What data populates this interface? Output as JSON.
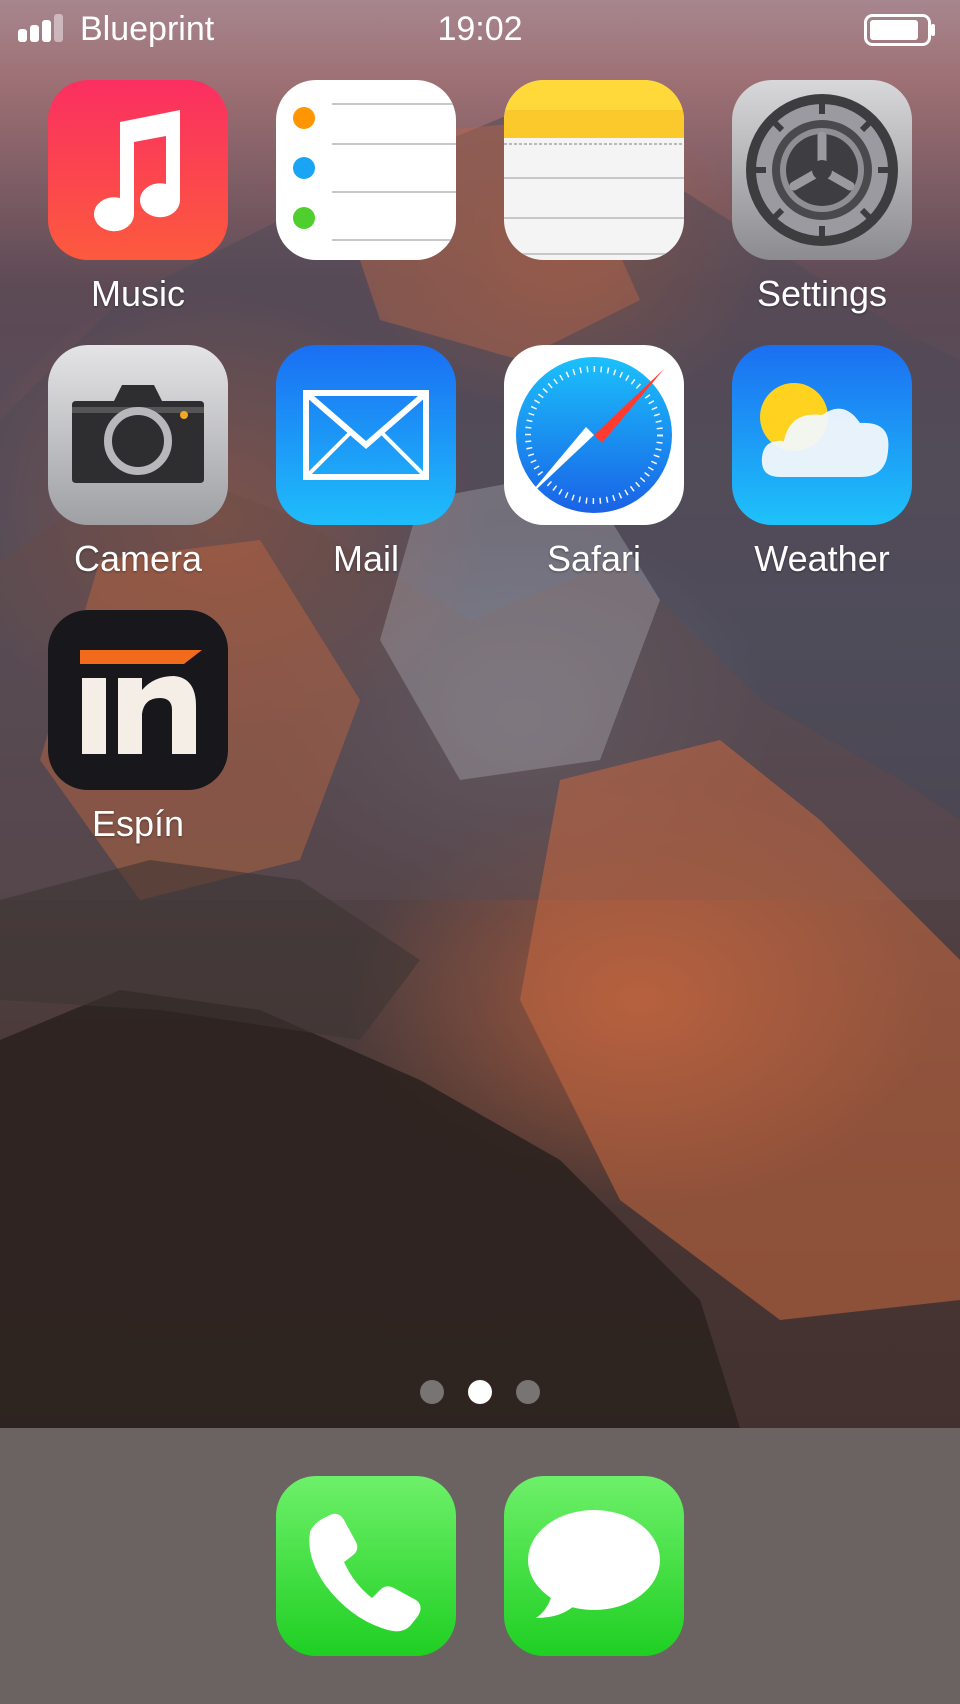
{
  "status_bar": {
    "carrier": "Blueprint",
    "time": "19:02",
    "signal_bars": 4
  },
  "apps": [
    {
      "label": "Music",
      "icon": "music-note-icon"
    },
    {
      "label": "",
      "icon": "reminders-list-icon"
    },
    {
      "label": "",
      "icon": "notes-pad-icon"
    },
    {
      "label": "Settings",
      "icon": "gear-icon"
    },
    {
      "label": "Camera",
      "icon": "camera-icon"
    },
    {
      "label": "Mail",
      "icon": "envelope-icon"
    },
    {
      "label": "Safari",
      "icon": "compass-icon"
    },
    {
      "label": "Weather",
      "icon": "sun-cloud-icon"
    },
    {
      "label": "Espín",
      "icon": "in-logo-icon"
    }
  ],
  "page_indicator": {
    "pages": 3,
    "current": 2
  },
  "dock": [
    {
      "label": "",
      "icon": "phone-icon"
    },
    {
      "label": "",
      "icon": "speech-bubble-icon"
    }
  ],
  "colors": {
    "music": "#fb3c5f",
    "mail": "#1b8cf8",
    "weather": "#1a8ff5",
    "espin_orange": "#f26a1b",
    "phone": "#3fdd3f",
    "messages": "#3fdd3f",
    "dock_bg": "#6a6361"
  }
}
